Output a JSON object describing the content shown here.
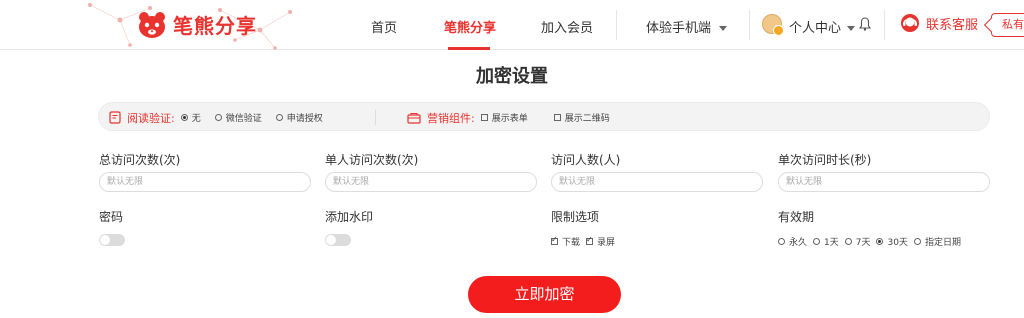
{
  "header": {
    "brand": "笔熊分享",
    "nav": [
      {
        "label": "首页"
      },
      {
        "label": "笔熊分享"
      },
      {
        "label": "加入会员"
      },
      {
        "label": "体验手机端"
      }
    ],
    "active_nav": "笔熊分享",
    "personal_center": "个人中心",
    "service": "联系客服",
    "message_tag": "私有"
  },
  "page": {
    "title": "加密设置"
  },
  "options_bar": {
    "read_verify": {
      "label": "阅读验证:",
      "options": [
        {
          "label": "无",
          "selected": true
        },
        {
          "label": "微信验证",
          "selected": false
        },
        {
          "label": "申请授权",
          "selected": false
        }
      ]
    },
    "marketing": {
      "label": "营销组件:",
      "options": [
        {
          "label": "展示表单",
          "checked": false
        },
        {
          "label": "展示二维码",
          "checked": false
        }
      ]
    }
  },
  "fields": {
    "total_visits": {
      "label": "总访问次数(次)",
      "placeholder": "默认无限"
    },
    "single_visits": {
      "label": "单人访问次数(次)",
      "placeholder": "默认无限"
    },
    "visitors": {
      "label": "访问人数(人)",
      "placeholder": "默认无限"
    },
    "single_duration": {
      "label": "单次访问时长(秒)",
      "placeholder": "默认无限"
    },
    "password": {
      "label": "密码",
      "enabled": false
    },
    "watermark": {
      "label": "添加水印",
      "enabled": false
    },
    "restrictions": {
      "label": "限制选项",
      "options": [
        {
          "label": "下载",
          "checked": true
        },
        {
          "label": "录屏",
          "checked": true
        }
      ]
    },
    "validity": {
      "label": "有效期",
      "options": [
        {
          "label": "永久",
          "selected": false
        },
        {
          "label": "1天",
          "selected": false
        },
        {
          "label": "7天",
          "selected": false
        },
        {
          "label": "30天",
          "selected": true
        },
        {
          "label": "指定日期",
          "selected": false
        }
      ]
    }
  },
  "submit_label": "立即加密",
  "colors": {
    "brand": "#e8332f",
    "submit": "#f41d1d"
  }
}
